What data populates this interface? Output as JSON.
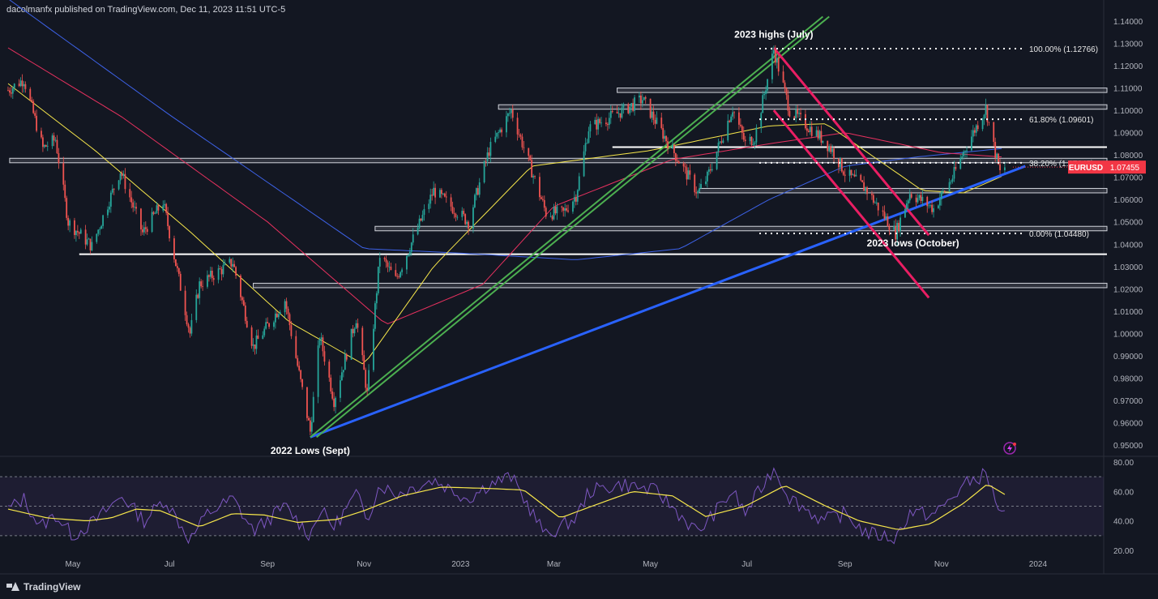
{
  "header": {
    "publisher": "dacolmanfx published on TradingView.com, Dec 11, 2023 11:51 UTC-5"
  },
  "footer": {
    "brand": "TradingView"
  },
  "colors": {
    "background": "#131722",
    "bull": "#26a69a",
    "bear": "#ef5350",
    "sma50": "#f7e74b",
    "sma100": "#e8315f",
    "sma200": "#3d62e8",
    "support_trend": "#2962ff",
    "up_channel": "#4caf50",
    "down_channel": "#e91e63",
    "rsi": "#7e57c2",
    "rsi_ma": "#f7e74b",
    "price_label": "#f23645"
  },
  "icons": [
    "tradingview-logo-icon",
    "lightning-icon"
  ],
  "chart_data": [
    {
      "type": "candlestick",
      "symbol": "EURUSD",
      "last_price": "1.07455",
      "ylim": [
        0.945,
        1.142
      ],
      "y_ticks": [
        "1.14000",
        "1.13000",
        "1.12000",
        "1.11000",
        "1.10000",
        "1.09000",
        "1.08000",
        "1.07000",
        "1.06000",
        "1.05000",
        "1.04000",
        "1.03000",
        "1.02000",
        "1.01000",
        "1.00000",
        "0.99000",
        "0.98000",
        "0.97000",
        "0.96000",
        "0.95000"
      ],
      "x_ticks": [
        "May",
        "Jul",
        "Sep",
        "Nov",
        "2023",
        "Mar",
        "May",
        "Jul",
        "Sep",
        "Nov",
        "2024"
      ],
      "x_range": [
        "2022-03-20",
        "2024-01-20"
      ],
      "price_path": [
        [
          "2022-03-21",
          1.109
        ],
        [
          "2022-03-31",
          1.114
        ],
        [
          "2022-04-12",
          1.083
        ],
        [
          "2022-04-20",
          1.087
        ],
        [
          "2022-04-28",
          1.05
        ],
        [
          "2022-05-13",
          1.039
        ],
        [
          "2022-05-31",
          1.073
        ],
        [
          "2022-06-14",
          1.045
        ],
        [
          "2022-06-27",
          1.059
        ],
        [
          "2022-07-14",
          1.0
        ],
        [
          "2022-07-20",
          1.022
        ],
        [
          "2022-08-10",
          1.032
        ],
        [
          "2022-08-23",
          0.994
        ],
        [
          "2022-09-12",
          1.015
        ],
        [
          "2022-09-28",
          0.956
        ],
        [
          "2022-10-04",
          0.999
        ],
        [
          "2022-10-13",
          0.97
        ],
        [
          "2022-10-27",
          1.007
        ],
        [
          "2022-11-03",
          0.973
        ],
        [
          "2022-11-11",
          1.035
        ],
        [
          "2022-11-21",
          1.024
        ],
        [
          "2022-12-15",
          1.064
        ],
        [
          "2023-01-06",
          1.05
        ],
        [
          "2023-01-19",
          1.082
        ],
        [
          "2023-02-02",
          1.1
        ],
        [
          "2023-02-24",
          1.054
        ],
        [
          "2023-03-07",
          1.054
        ],
        [
          "2023-03-15",
          1.062
        ],
        [
          "2023-03-23",
          1.092
        ],
        [
          "2023-04-14",
          1.1
        ],
        [
          "2023-04-26",
          1.105
        ],
        [
          "2023-05-31",
          1.063
        ],
        [
          "2023-06-06",
          1.07
        ],
        [
          "2023-06-22",
          1.101
        ],
        [
          "2023-06-30",
          1.085
        ],
        [
          "2023-07-06",
          1.088
        ],
        [
          "2023-07-18",
          1.127
        ],
        [
          "2023-07-28",
          1.1
        ],
        [
          "2023-08-18",
          1.087
        ],
        [
          "2023-08-24",
          1.082
        ],
        [
          "2023-09-01",
          1.072
        ],
        [
          "2023-09-14",
          1.065
        ],
        [
          "2023-10-03",
          1.045
        ],
        [
          "2023-10-12",
          1.063
        ],
        [
          "2023-10-27",
          1.056
        ],
        [
          "2023-11-08",
          1.07
        ],
        [
          "2023-11-16",
          1.083
        ],
        [
          "2023-11-29",
          1.101
        ],
        [
          "2023-12-04",
          1.084
        ],
        [
          "2023-12-08",
          1.072
        ],
        [
          "2023-12-11",
          1.0745
        ]
      ],
      "sma50": [
        [
          "2022-03-21",
          1.112
        ],
        [
          "2022-05-15",
          1.082
        ],
        [
          "2022-07-15",
          1.045
        ],
        [
          "2022-09-15",
          1.005
        ],
        [
          "2022-11-01",
          0.986
        ],
        [
          "2022-12-15",
          1.03
        ],
        [
          "2023-02-15",
          1.075
        ],
        [
          "2023-05-01",
          1.082
        ],
        [
          "2023-07-15",
          1.093
        ],
        [
          "2023-08-20",
          1.094
        ],
        [
          "2023-10-20",
          1.064
        ],
        [
          "2023-11-15",
          1.063
        ],
        [
          "2023-12-11",
          1.071
        ]
      ],
      "sma100": [
        [
          "2022-03-21",
          1.128
        ],
        [
          "2022-06-01",
          1.097
        ],
        [
          "2022-09-01",
          1.05
        ],
        [
          "2022-11-15",
          1.004
        ],
        [
          "2023-01-15",
          1.022
        ],
        [
          "2023-03-01",
          1.057
        ],
        [
          "2023-05-15",
          1.078
        ],
        [
          "2023-07-15",
          1.085
        ],
        [
          "2023-09-01",
          1.09
        ],
        [
          "2023-11-01",
          1.081
        ],
        [
          "2023-12-11",
          1.079
        ]
      ],
      "sma200": [
        [
          "2022-03-21",
          1.15
        ],
        [
          "2022-07-01",
          1.098
        ],
        [
          "2022-11-01",
          1.038
        ],
        [
          "2023-01-01",
          1.036
        ],
        [
          "2023-03-15",
          1.033
        ],
        [
          "2023-05-20",
          1.038
        ],
        [
          "2023-07-15",
          1.06
        ],
        [
          "2023-09-01",
          1.075
        ],
        [
          "2023-10-15",
          1.079
        ],
        [
          "2023-12-11",
          1.083
        ]
      ],
      "horizontal_levels": [
        {
          "kind": "zone",
          "price_top": 1.11,
          "price_bottom": 1.108,
          "from": "2023-04-10"
        },
        {
          "kind": "zone",
          "price_top": 1.1025,
          "price_bottom": 1.1005,
          "from": "2023-01-25"
        },
        {
          "kind": "line",
          "price": 1.0835,
          "from": "2023-04-07"
        },
        {
          "kind": "zone",
          "price_top": 1.0785,
          "price_bottom": 1.0765,
          "from": "2022-03-22"
        },
        {
          "kind": "zone",
          "price_top": 1.065,
          "price_bottom": 1.063,
          "from": "2023-06-01"
        },
        {
          "kind": "zone",
          "price_top": 1.048,
          "price_bottom": 1.046,
          "from": "2022-11-08"
        },
        {
          "kind": "line",
          "price": 1.0355,
          "from": "2022-05-05"
        },
        {
          "kind": "zone",
          "price_top": 1.0225,
          "price_bottom": 1.0205,
          "from": "2022-08-23"
        }
      ],
      "fibonacci": [
        {
          "label": "100.00% (1.12766)",
          "price": 1.12766
        },
        {
          "label": "61.80% (1.09601)",
          "price": 1.09601
        },
        {
          "label": "38.20% (1.07645)",
          "price": 1.07645
        },
        {
          "label": "0.00% (1.04480)",
          "price": 1.0448
        }
      ],
      "trendlines": [
        {
          "name": "support",
          "from": [
            "2022-09-28",
            0.9535
          ],
          "to": [
            "2023-12-24",
            1.075
          ]
        },
        {
          "name": "up-channel-a",
          "from": [
            "2022-09-28",
            0.9535
          ],
          "to": [
            "2023-08-18",
            1.142
          ]
        },
        {
          "name": "up-channel-b",
          "from": [
            "2022-10-02",
            0.9535
          ],
          "to": [
            "2023-08-22",
            1.142
          ]
        },
        {
          "name": "down-channel-a",
          "from": [
            "2023-07-18",
            1.128
          ],
          "to": [
            "2023-10-24",
            1.044
          ]
        },
        {
          "name": "down-channel-b",
          "from": [
            "2023-07-18",
            1.1
          ],
          "to": [
            "2023-10-24",
            1.016
          ]
        }
      ],
      "annotations": [
        {
          "text": "2023 highs (July)",
          "date": "2023-07-18",
          "price": 1.134
        },
        {
          "text": "2022 Lows (Sept)",
          "date": "2022-09-28",
          "price": 0.9475
        },
        {
          "text": "2023 lows (October)",
          "date": "2023-10-14",
          "price": 1.0405
        }
      ]
    },
    {
      "type": "line",
      "name": "RSI",
      "ylim": [
        13,
        82
      ],
      "y_ticks": [
        "80.00",
        "60.00",
        "40.00",
        "20.00"
      ],
      "bands": [
        70,
        50,
        30
      ],
      "rsi": [
        [
          "2022-03-21",
          48
        ],
        [
          "2022-03-31",
          55
        ],
        [
          "2022-04-10",
          36
        ],
        [
          "2022-04-20",
          44
        ],
        [
          "2022-05-01",
          30
        ],
        [
          "2022-05-15",
          40
        ],
        [
          "2022-06-01",
          57
        ],
        [
          "2022-06-15",
          40
        ],
        [
          "2022-06-28",
          55
        ],
        [
          "2022-07-14",
          27
        ],
        [
          "2022-07-25",
          45
        ],
        [
          "2022-08-10",
          55
        ],
        [
          "2022-08-23",
          33
        ],
        [
          "2022-09-12",
          50
        ],
        [
          "2022-09-28",
          30
        ],
        [
          "2022-10-04",
          48
        ],
        [
          "2022-10-13",
          36
        ],
        [
          "2022-10-27",
          58
        ],
        [
          "2022-11-03",
          42
        ],
        [
          "2022-11-11",
          65
        ],
        [
          "2022-11-21",
          58
        ],
        [
          "2022-12-15",
          68
        ],
        [
          "2023-01-06",
          55
        ],
        [
          "2023-01-19",
          65
        ],
        [
          "2023-02-02",
          70
        ],
        [
          "2023-02-24",
          30
        ],
        [
          "2023-03-15",
          42
        ],
        [
          "2023-03-23",
          60
        ],
        [
          "2023-04-14",
          65
        ],
        [
          "2023-05-05",
          60
        ],
        [
          "2023-05-31",
          32
        ],
        [
          "2023-06-22",
          60
        ],
        [
          "2023-06-30",
          45
        ],
        [
          "2023-07-18",
          76
        ],
        [
          "2023-07-28",
          56
        ],
        [
          "2023-08-18",
          40
        ],
        [
          "2023-09-01",
          45
        ],
        [
          "2023-09-14",
          32
        ],
        [
          "2023-10-03",
          28
        ],
        [
          "2023-10-12",
          46
        ],
        [
          "2023-10-27",
          44
        ],
        [
          "2023-11-08",
          56
        ],
        [
          "2023-11-16",
          65
        ],
        [
          "2023-11-29",
          72
        ],
        [
          "2023-12-04",
          58
        ],
        [
          "2023-12-08",
          46
        ],
        [
          "2023-12-11",
          43
        ]
      ],
      "rsi_ma": [
        [
          "2022-03-21",
          48
        ],
        [
          "2022-04-15",
          42
        ],
        [
          "2022-05-10",
          40
        ],
        [
          "2022-05-25",
          42
        ],
        [
          "2022-06-10",
          48
        ],
        [
          "2022-06-25",
          47
        ],
        [
          "2022-07-20",
          36
        ],
        [
          "2022-08-10",
          45
        ],
        [
          "2022-08-30",
          44
        ],
        [
          "2022-09-20",
          39
        ],
        [
          "2022-10-15",
          41
        ],
        [
          "2022-11-01",
          47
        ],
        [
          "2022-11-25",
          57
        ],
        [
          "2022-12-20",
          63
        ],
        [
          "2023-01-20",
          62
        ],
        [
          "2023-02-10",
          61
        ],
        [
          "2023-03-05",
          42
        ],
        [
          "2023-03-25",
          50
        ],
        [
          "2023-04-20",
          60
        ],
        [
          "2023-05-15",
          57
        ],
        [
          "2023-06-05",
          43
        ],
        [
          "2023-06-30",
          50
        ],
        [
          "2023-07-25",
          64
        ],
        [
          "2023-08-20",
          50
        ],
        [
          "2023-09-10",
          40
        ],
        [
          "2023-10-05",
          34
        ],
        [
          "2023-10-25",
          38
        ],
        [
          "2023-11-15",
          52
        ],
        [
          "2023-11-30",
          65
        ],
        [
          "2023-12-11",
          58
        ]
      ]
    }
  ]
}
